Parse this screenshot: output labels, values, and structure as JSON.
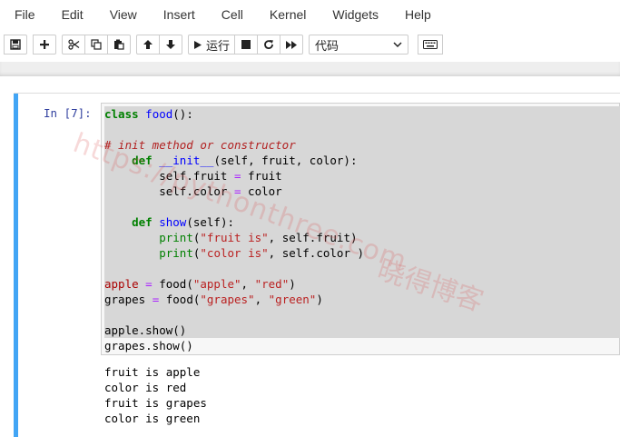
{
  "menubar": {
    "items": [
      "File",
      "Edit",
      "View",
      "Insert",
      "Cell",
      "Kernel",
      "Widgets",
      "Help"
    ]
  },
  "toolbar": {
    "save_icon": "save-icon",
    "insert_icon": "plus-icon",
    "cut_icon": "scissors-icon",
    "copy_icon": "copy-icon",
    "paste_icon": "paste-icon",
    "move_up_icon": "arrow-up-icon",
    "move_down_icon": "arrow-down-icon",
    "run_label": "运行",
    "stop_icon": "stop-icon",
    "restart_icon": "restart-icon",
    "fastforward_icon": "fast-forward-icon",
    "cell_type": "代码",
    "keyboard_icon": "keyboard-icon"
  },
  "cell": {
    "prompt": "In  [7]:",
    "accent_color": "#42a5f5",
    "output": [
      "fruit is apple",
      "color is red",
      "fruit is grapes",
      "color is green"
    ]
  },
  "watermark": {
    "url": "https://pythonthree.com",
    "text": "晓得博客"
  }
}
